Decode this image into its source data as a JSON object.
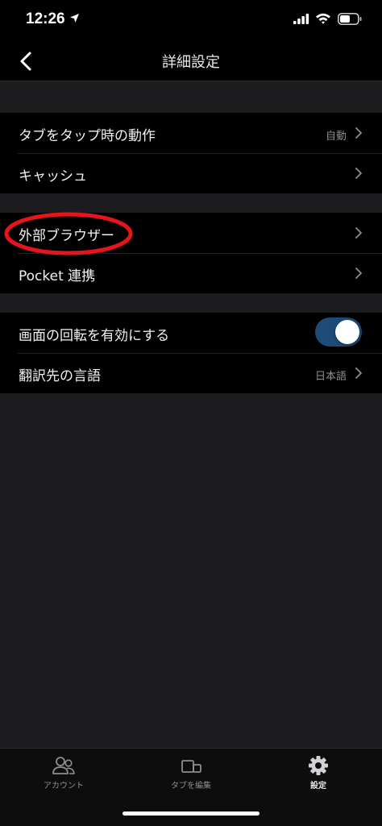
{
  "status_bar": {
    "time": "12:26"
  },
  "nav": {
    "title": "詳細設定"
  },
  "groups": [
    {
      "rows": [
        {
          "label": "タブをタップ時の動作",
          "value": "自動"
        },
        {
          "label": "キャッシュ",
          "value": ""
        }
      ]
    },
    {
      "rows": [
        {
          "label": "外部ブラウザー",
          "value": ""
        },
        {
          "label": "Pocket 連携",
          "value": ""
        }
      ]
    },
    {
      "rows": [
        {
          "label": "画面の回転を有効にする",
          "toggle": true
        },
        {
          "label": "翻訳先の言語",
          "value": "日本語"
        }
      ]
    }
  ],
  "tab_bar": {
    "tabs": [
      {
        "label": "アカウント",
        "icon": "account-icon"
      },
      {
        "label": "タブを編集",
        "icon": "edit-tabs-icon"
      },
      {
        "label": "設定",
        "icon": "gear-icon"
      }
    ],
    "active_index": 2
  },
  "colors": {
    "background": "#1c1c1e",
    "group_background": "#000000",
    "toggle_on": "#1c4b78",
    "highlight_ellipse": "#e8141c",
    "secondary_text": "#8e8e93"
  }
}
